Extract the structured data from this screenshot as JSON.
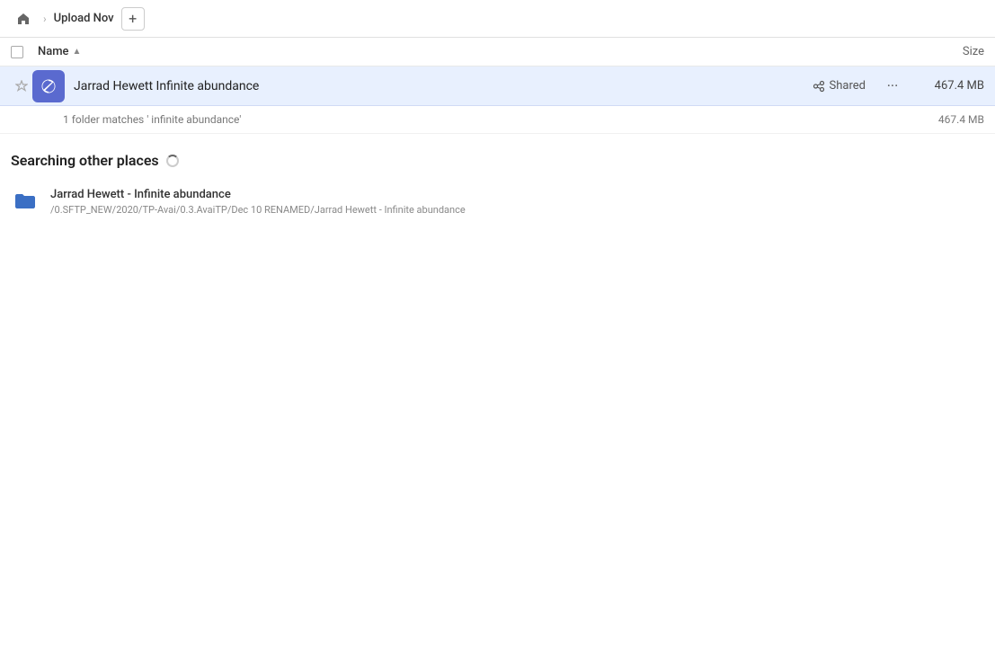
{
  "topbar": {
    "home_label": "Home",
    "breadcrumb_current": "Upload Nov",
    "new_tab_icon": "+"
  },
  "columns": {
    "name_label": "Name",
    "name_sort": "▲",
    "size_label": "Size"
  },
  "primary_result": {
    "name": "Jarrad Hewett Infinite abundance",
    "shared_label": "Shared",
    "more_icon": "···",
    "size": "467.4 MB"
  },
  "summary": {
    "text": "1 folder matches ' infinite abundance'",
    "size": "467.4 MB"
  },
  "other_section": {
    "title": "Searching other places"
  },
  "other_results": [
    {
      "name": "Jarrad Hewett - Infinite abundance",
      "path": "/0.SFTP_NEW/2020/TP-Avai/0.3.AvaiTP/Dec 10 RENAMED/Jarrad Hewett - Infinite abundance"
    }
  ]
}
